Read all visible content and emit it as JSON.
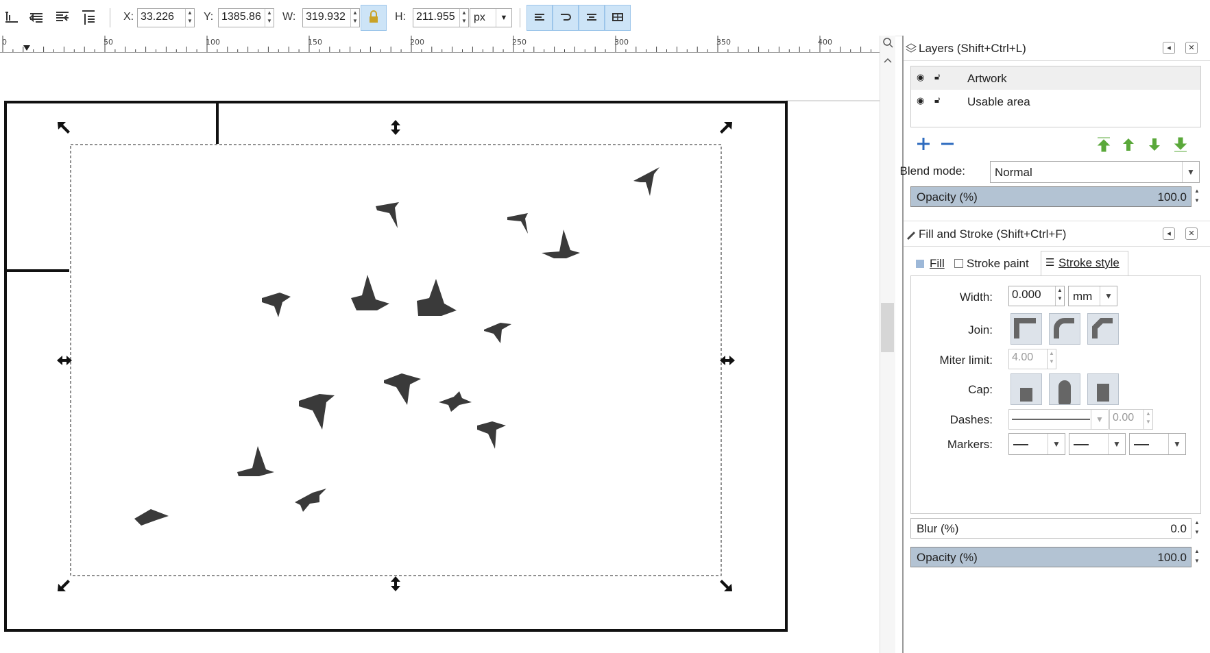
{
  "toolbar": {
    "x_label": "X:",
    "x_value": "33.226",
    "y_label": "Y:",
    "y_value": "1385.86",
    "w_label": "W:",
    "w_value": "319.932",
    "h_label": "H:",
    "h_value": "211.955",
    "unit": "px",
    "lock_icon": "lock-icon"
  },
  "ruler": {
    "labels": [
      "0",
      "50",
      "100",
      "150",
      "200",
      "250",
      "300",
      "350",
      "400"
    ]
  },
  "layers": {
    "title": "Layers (Shift+Ctrl+L)",
    "items": [
      {
        "name": "Artwork"
      },
      {
        "name": "Usable area"
      }
    ],
    "blend_label": "Blend mode:",
    "blend_value": "Normal",
    "opacity_label": "Opacity (%)",
    "opacity_value": "100.0"
  },
  "fill_stroke": {
    "title": "Fill and Stroke (Shift+Ctrl+F)",
    "tabs": [
      {
        "label": "Fill"
      },
      {
        "label": "Stroke paint"
      },
      {
        "label": "Stroke style"
      }
    ],
    "width_label": "Width:",
    "width_value": "0.000",
    "width_unit": "mm",
    "join_label": "Join:",
    "miter_label": "Miter limit:",
    "miter_value": "4.00",
    "cap_label": "Cap:",
    "dashes_label": "Dashes:",
    "dashes_value": "0.00",
    "markers_label": "Markers:",
    "blur_label": "Blur (%)",
    "blur_value": "0.0",
    "opacity_label": "Opacity (%)",
    "opacity_value": "100.0"
  },
  "colors": {
    "accent": "#cde4f7",
    "bar_fill": "#b3c3d3",
    "bird": "#3a3a3a",
    "green_arrow": "#5aa83a",
    "blue_plus": "#2d6bbf"
  }
}
